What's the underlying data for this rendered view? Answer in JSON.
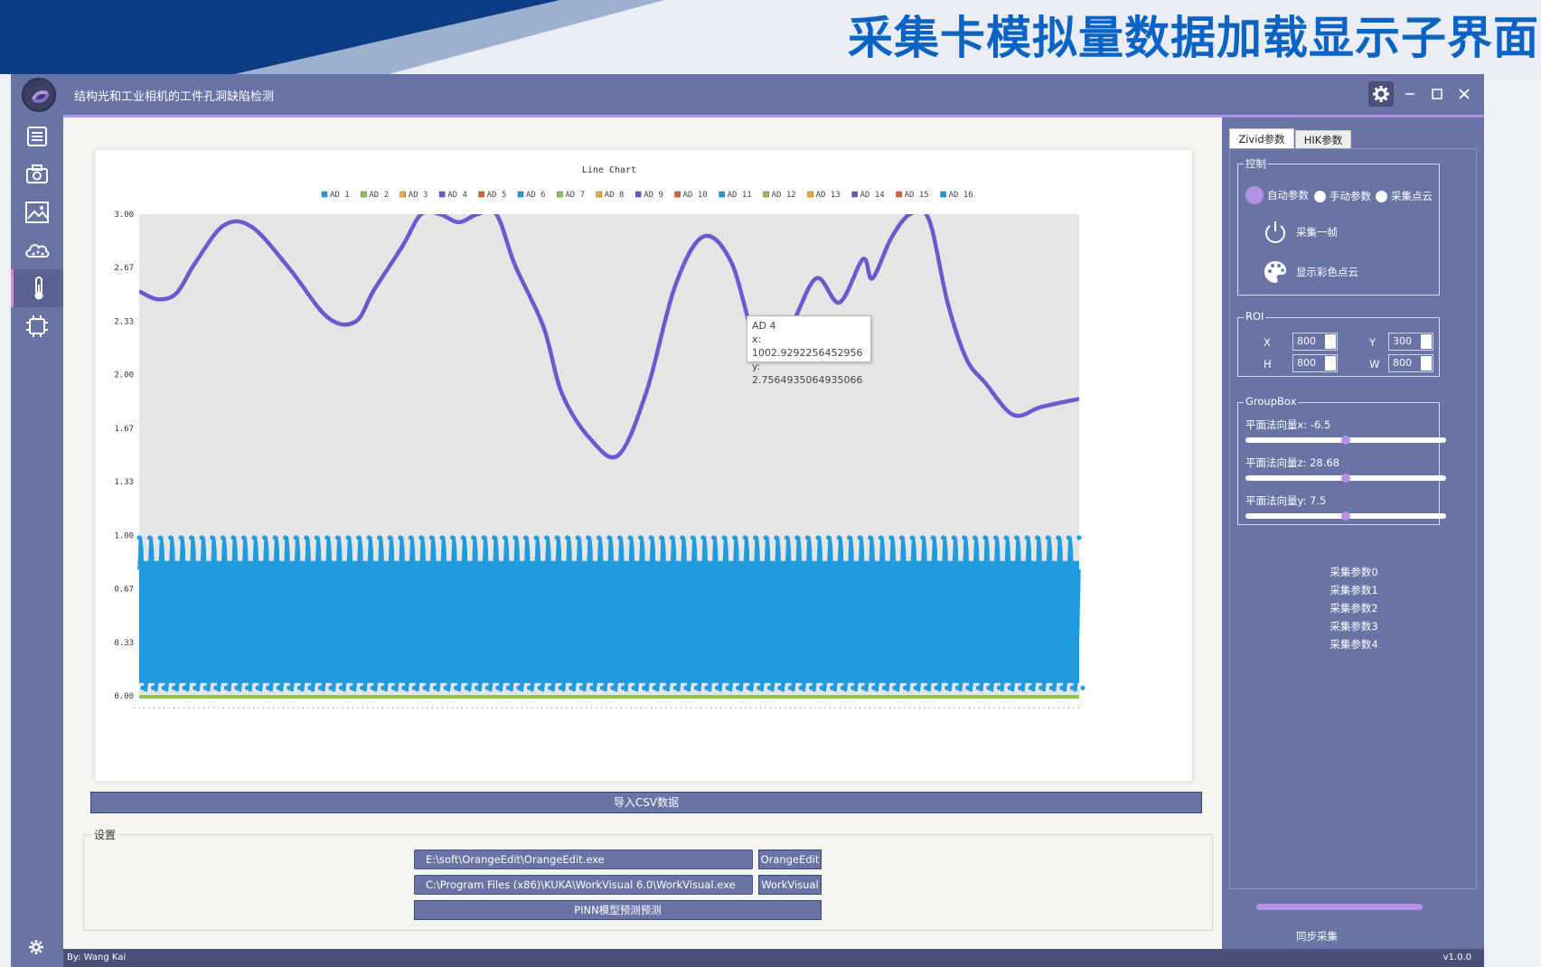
{
  "slide": {
    "title": "采集卡模拟量数据加载显示子界面"
  },
  "app": {
    "title": "结构光和工业相机的工件孔洞缺陷检测",
    "accent": "#b591e6",
    "window_controls": [
      "gear-icon",
      "minimize-icon",
      "maximize-icon",
      "close-icon"
    ]
  },
  "sidebar": {
    "items": [
      {
        "icon": "list-icon"
      },
      {
        "icon": "camera-icon"
      },
      {
        "icon": "image-icon"
      },
      {
        "icon": "cloud-network-icon"
      },
      {
        "icon": "thermometer-icon",
        "active": true
      },
      {
        "icon": "chip-icon"
      }
    ],
    "bottom_icon": "gear-icon"
  },
  "tooltip": {
    "series": "AD 4",
    "x_text": "x: 1002.9292256452956",
    "y_text": "y: 2.7564935064935066"
  },
  "chart_data": {
    "type": "line",
    "title": "Line Chart",
    "xlabel": "",
    "ylabel": "",
    "ylim": [
      0,
      3
    ],
    "yticks": [
      "0.00",
      "0.33",
      "0.67",
      "1.00",
      "1.33",
      "1.67",
      "2.00",
      "2.33",
      "2.67",
      "3.00"
    ],
    "x_range": [
      0,
      1000
    ],
    "legend": [
      "AD 1",
      "AD 2",
      "AD 3",
      "AD 4",
      "AD 5",
      "AD 6",
      "AD 7",
      "AD 8",
      "AD 9",
      "AD 10",
      "AD 11",
      "AD 12",
      "AD 13",
      "AD 14",
      "AD 15",
      "AD 16"
    ],
    "legend_colors": [
      "#1f9bde",
      "#8fc64f",
      "#f0b222",
      "#6a5acd",
      "#e0602e",
      "#1f9bde",
      "#8fc64f",
      "#f0b222",
      "#6a5acd",
      "#e0602e",
      "#1f9bde",
      "#8fc64f",
      "#f0b222",
      "#6a5acd",
      "#e0602e",
      "#1f9bde"
    ],
    "legend_placement": "top",
    "grid": true,
    "series": [
      {
        "name": "AD 4",
        "color": "#6a5acd",
        "x": [
          0,
          20,
          40,
          60,
          90,
          120,
          160,
          200,
          230,
          250,
          280,
          300,
          320,
          340,
          360,
          380,
          400,
          430,
          450,
          480,
          510,
          540,
          570,
          600,
          630,
          660,
          690,
          720,
          745,
          770,
          780,
          800,
          820,
          840,
          860,
          880,
          900,
          930,
          960,
          1000
        ],
        "y": [
          2.52,
          2.47,
          2.51,
          2.7,
          2.93,
          2.92,
          2.66,
          2.36,
          2.33,
          2.53,
          2.8,
          3.0,
          3.0,
          2.95,
          3.0,
          3.0,
          2.68,
          2.3,
          1.88,
          1.6,
          1.5,
          1.9,
          2.55,
          2.86,
          2.7,
          2.15,
          2.27,
          2.6,
          2.45,
          2.72,
          2.6,
          2.85,
          3.0,
          2.97,
          2.45,
          2.1,
          1.95,
          1.75,
          1.8,
          1.85
        ]
      },
      {
        "name": "AD 1",
        "color": "#1f9bde",
        "band_min": 0.02,
        "band_max": 1.0,
        "cycles": 90
      },
      {
        "name": "AD 2",
        "color": "#8fc64f",
        "constant": 0.0
      }
    ]
  },
  "main": {
    "import_button": "导入CSV数据",
    "settings": {
      "title": "设置",
      "rows": [
        {
          "path": "E:\\soft\\OrangeEdit\\OrangeEdit.exe",
          "button": "OrangeEdit"
        },
        {
          "path": "C:\\Program Files (x86)\\KUKA\\WorkVisual 6.0\\WorkVisual.exe",
          "button": "WorkVisual"
        }
      ],
      "pinn_button": "PINN模型预测预测"
    }
  },
  "right": {
    "tabs": [
      "Zivid参数",
      "HIK参数"
    ],
    "control": {
      "title": "控制",
      "radios": [
        "自动参数",
        "手动参数",
        "采集点云"
      ],
      "selected": 0,
      "capture_label": "采集一帧",
      "color_label": "显示彩色点云"
    },
    "roi": {
      "title": "ROI",
      "x_label": "X",
      "x_value": "800",
      "y_label": "Y",
      "y_value": "300",
      "h_label": "H",
      "h_value": "800",
      "w_label": "W",
      "w_value": "800"
    },
    "groupbox": {
      "title": "GroupBox",
      "sliders": [
        {
          "label": "平面法向量x: -6.5",
          "pos": 0.5
        },
        {
          "label": "平面法向量z: 28.68",
          "pos": 0.5
        },
        {
          "label": "平面法向量y: 7.5",
          "pos": 0.5
        }
      ]
    },
    "params": [
      "采集参数0",
      "采集参数1",
      "采集参数2",
      "采集参数3",
      "采集参数4"
    ],
    "sync_label": "同步采集"
  },
  "status": {
    "author": "By: Wang Kai",
    "version": "v1.0.0"
  }
}
